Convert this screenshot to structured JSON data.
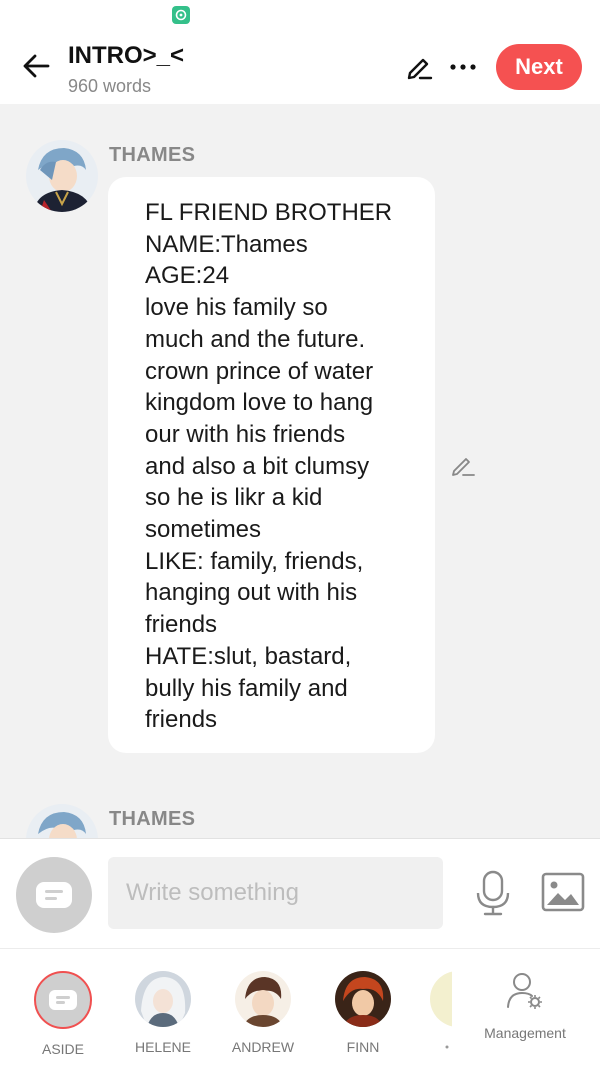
{
  "header": {
    "title": "INTRO>_<",
    "word_count": "960 words",
    "next_label": "Next"
  },
  "messages": [
    {
      "speaker": "THAMES",
      "lines": [
        "FL FRIEND BROTHER",
        "NAME:Thames",
        "AGE:24",
        "love his family so",
        "much and the future.",
        "crown prince of water",
        "kingdom love to hang",
        "our with his friends",
        "and also a bit clumsy",
        "so he is likr a kid",
        "sometimes",
        "LIKE: family, friends,",
        "hanging out with his",
        "friends",
        "HATE:slut, bastard,",
        "bully his family and",
        "friends"
      ]
    },
    {
      "speaker": "THAMES"
    }
  ],
  "composer": {
    "placeholder": "Write something"
  },
  "characters": [
    {
      "label": "ASIDE",
      "selected": true
    },
    {
      "label": "HELENE"
    },
    {
      "label": "ANDREW"
    },
    {
      "label": "FINN"
    }
  ],
  "management_label": "Management",
  "colors": {
    "accent": "#f55151",
    "background": "#f2f2f2",
    "muted_text": "#888888"
  }
}
